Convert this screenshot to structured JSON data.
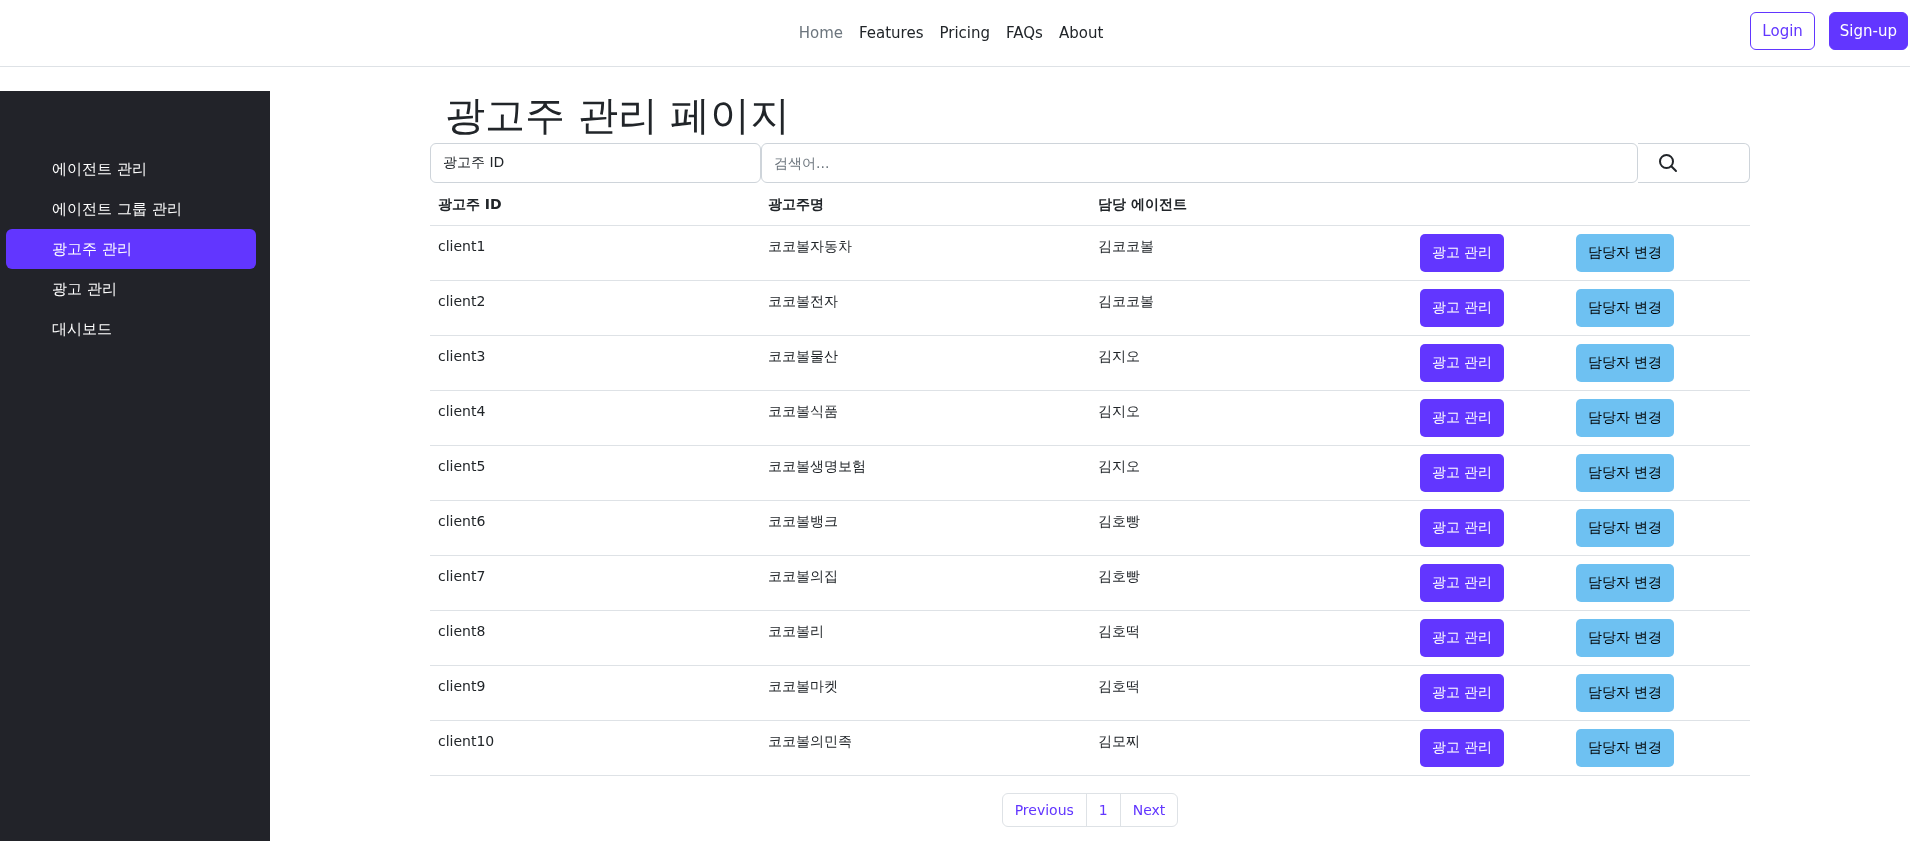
{
  "nav": {
    "links": [
      {
        "label": "Home",
        "selected": true
      },
      {
        "label": "Features",
        "selected": false
      },
      {
        "label": "Pricing",
        "selected": false
      },
      {
        "label": "FAQs",
        "selected": false
      },
      {
        "label": "About",
        "selected": false
      }
    ],
    "login": "Login",
    "signup": "Sign-up"
  },
  "sidebar": {
    "items": [
      {
        "label": "에이전트 관리",
        "selected": false
      },
      {
        "label": "에이전트 그룹 관리",
        "selected": false
      },
      {
        "label": "광고주 관리",
        "selected": true
      },
      {
        "label": "광고 관리",
        "selected": false
      },
      {
        "label": "대시보드",
        "selected": false
      }
    ]
  },
  "page_title": "광고주 관리 페이지",
  "search": {
    "filter": "광고주 ID",
    "placeholder": "검색어..."
  },
  "table": {
    "columns": [
      "광고주 ID",
      "광고주명",
      "담당 에이전트"
    ],
    "rows": [
      {
        "id": "client1",
        "name": "코코볼자동차",
        "agent": "김코코볼",
        "manage": "광고 관리",
        "change": "담당자 변경"
      },
      {
        "id": "client2",
        "name": "코코볼전자",
        "agent": "김코코볼",
        "manage": "광고 관리",
        "change": "담당자 변경"
      },
      {
        "id": "client3",
        "name": "코코볼물산",
        "agent": "김지오",
        "manage": "광고 관리",
        "change": "담당자 변경"
      },
      {
        "id": "client4",
        "name": "코코볼식품",
        "agent": "김지오",
        "manage": "광고 관리",
        "change": "담당자 변경"
      },
      {
        "id": "client5",
        "name": "코코볼생명보험",
        "agent": "김지오",
        "manage": "광고 관리",
        "change": "담당자 변경"
      },
      {
        "id": "client6",
        "name": "코코볼뱅크",
        "agent": "김호빵",
        "manage": "광고 관리",
        "change": "담당자 변경"
      },
      {
        "id": "client7",
        "name": "코코볼의집",
        "agent": "김호빵",
        "manage": "광고 관리",
        "change": "담당자 변경"
      },
      {
        "id": "client8",
        "name": "코코볼리",
        "agent": "김호떡",
        "manage": "광고 관리",
        "change": "담당자 변경"
      },
      {
        "id": "client9",
        "name": "코코볼마켓",
        "agent": "김호떡",
        "manage": "광고 관리",
        "change": "담당자 변경"
      },
      {
        "id": "client10",
        "name": "코코볼의민족",
        "agent": "김모찌",
        "manage": "광고 관리",
        "change": "담당자 변경"
      }
    ]
  },
  "pagination": {
    "previous": "Previous",
    "pages": [
      "1"
    ],
    "next": "Next"
  }
}
